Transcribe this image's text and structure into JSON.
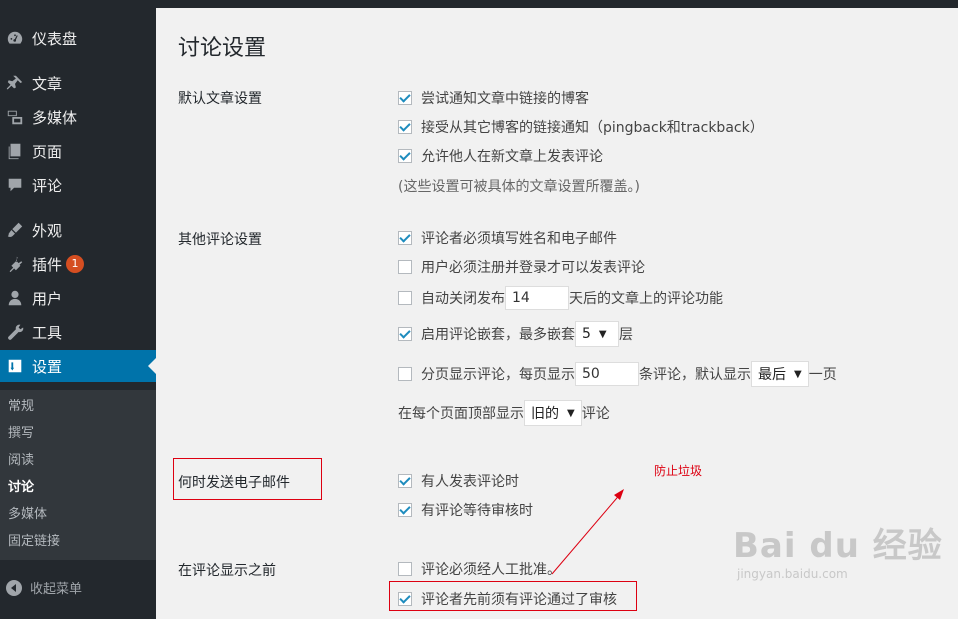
{
  "sidebar": {
    "items": [
      {
        "label": "仪表盘",
        "icon": "dashboard-icon"
      },
      {
        "label": "文章",
        "icon": "pin-icon"
      },
      {
        "label": "多媒体",
        "icon": "media-icon"
      },
      {
        "label": "页面",
        "icon": "page-icon"
      },
      {
        "label": "评论",
        "icon": "comment-icon"
      },
      {
        "label": "外观",
        "icon": "appearance-icon"
      },
      {
        "label": "插件",
        "icon": "plugin-icon",
        "badge": "1"
      },
      {
        "label": "用户",
        "icon": "user-icon"
      },
      {
        "label": "工具",
        "icon": "wrench-icon"
      },
      {
        "label": "设置",
        "icon": "settings-icon",
        "active": true
      }
    ],
    "submenu": [
      "常规",
      "撰写",
      "阅读",
      "讨论",
      "多媒体",
      "固定链接"
    ],
    "submenu_current": "讨论",
    "collapse_label": "收起菜单"
  },
  "page": {
    "title": "讨论设置"
  },
  "default_article": {
    "label": "默认文章设置",
    "options": [
      {
        "text": "尝试通知文章中链接的博客",
        "checked": true
      },
      {
        "text": "接受从其它博客的链接通知（pingback和trackback）",
        "checked": true
      },
      {
        "text": "允许他人在新文章上发表评论",
        "checked": true
      }
    ],
    "note": "(这些设置可被具体的文章设置所覆盖。)"
  },
  "other_comments": {
    "label": "其他评论设置",
    "require_name_email": {
      "text": "评论者必须填写姓名和电子邮件",
      "checked": true
    },
    "registered_only": {
      "text": "用户必须注册并登录才可以发表评论",
      "checked": false
    },
    "auto_close": {
      "before": "自动关闭发布",
      "value": "14",
      "after": "天后的文章上的评论功能",
      "checked": false
    },
    "threaded": {
      "before": "启用评论嵌套，最多嵌套",
      "value": "5",
      "after": "层",
      "checked": true
    },
    "paged": {
      "before": "分页显示评论，每页显示",
      "value": "50",
      "middle": "条评论，默认显示",
      "select": "最后",
      "after": "一页",
      "checked": false
    },
    "order": {
      "before": "在每个页面顶部显示",
      "select": "旧的",
      "after": "评论"
    }
  },
  "email_me": {
    "label": "何时发送电子邮件",
    "options": [
      {
        "text": "有人发表评论时",
        "checked": true
      },
      {
        "text": "有评论等待审核时",
        "checked": true
      }
    ]
  },
  "before_appear": {
    "label": "在评论显示之前",
    "options": [
      {
        "text": "评论必须经人工批准。",
        "checked": false
      },
      {
        "text": "评论者先前须有评论通过了审核",
        "checked": true
      }
    ]
  },
  "annotation": {
    "text": "防止垃圾",
    "color": "#dd0011"
  },
  "watermark": {
    "brand": "Bai du 经验",
    "url": "jingyan.baidu.com"
  }
}
